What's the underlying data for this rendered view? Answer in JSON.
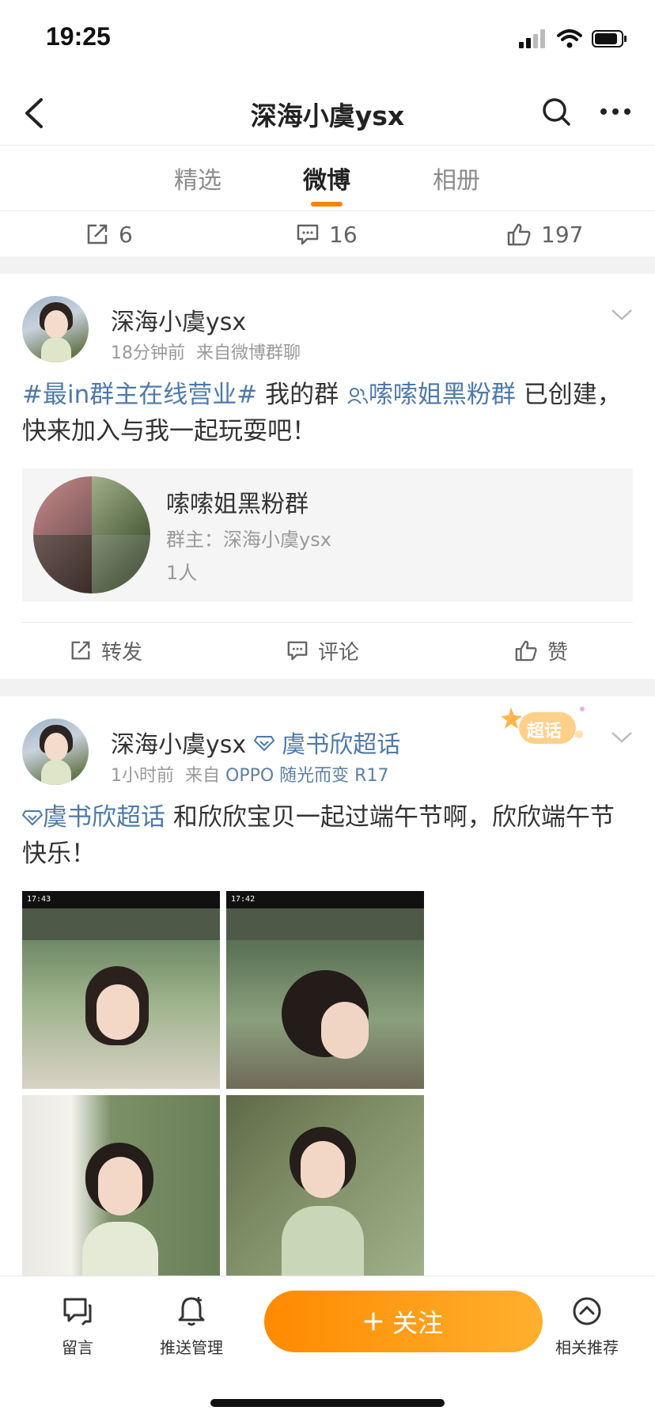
{
  "status": {
    "time": "19:25"
  },
  "nav": {
    "title": "深海小虞ysx"
  },
  "tabs": [
    {
      "label": "精选"
    },
    {
      "label": "微博"
    },
    {
      "label": "相册"
    }
  ],
  "prev_post_stats": {
    "reposts": "6",
    "comments": "16",
    "likes": "197"
  },
  "post1": {
    "username": "深海小虞ysx",
    "time": "18分钟前",
    "source": "来自微博群聊",
    "hashtag": "#最in群主在线营业#",
    "text_a": " 我的群 ",
    "group_link": "嗦嗦姐黑粉群",
    "text_b": " 已创建，快来加入与我一起玩耍吧！",
    "card": {
      "name": "嗦嗦姐黑粉群",
      "owner": "群主：深海小虞ysx",
      "members": "1人"
    },
    "actions": {
      "repost": "转发",
      "comment": "评论",
      "like": "赞"
    }
  },
  "post2": {
    "username": "深海小虞ysx",
    "topic_link": "虞书欣超话",
    "time": "1小时前",
    "source_prefix": "来自",
    "source_device": "OPPO 随光而变 R17",
    "badge": "超话",
    "content_link": "虞书欣超话",
    "content_text": " 和欣欣宝贝一起过端午节啊，欣欣端午节快乐！",
    "photos": [
      {
        "status_time": "17:43"
      },
      {
        "status_time": "17:42"
      },
      {
        "status_time": ""
      },
      {
        "status_time": ""
      }
    ]
  },
  "bottom_bar": {
    "message": "留言",
    "push": "推送管理",
    "follow": "关注",
    "related": "相关推荐"
  },
  "colors": {
    "accent": "#ff8200",
    "link": "#4d7aab"
  }
}
